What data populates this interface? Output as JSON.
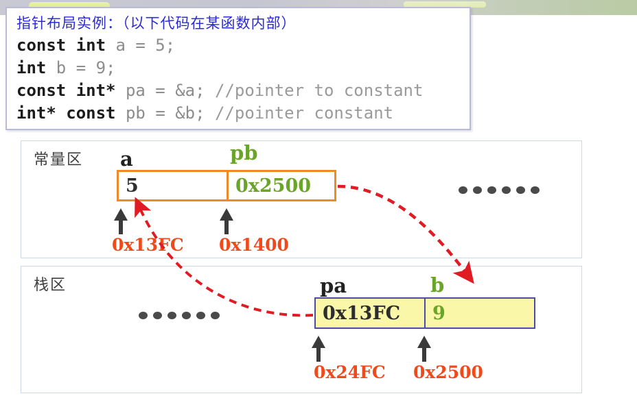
{
  "code_card": {
    "title": "指针布局实例：（以下代码在某函数内部）",
    "lines": [
      {
        "kw1": "const int",
        "rest": " a = 5;",
        "comment": ""
      },
      {
        "kw1": "int",
        "rest": " b = 9;",
        "comment": ""
      },
      {
        "kw1": "const int",
        "star": "*",
        "rest": " pa = &a; ",
        "comment": "//pointer to constant"
      },
      {
        "kw1": "int",
        "star": "*",
        "kw2": " const",
        "rest": " pb = &b; ",
        "comment": "//pointer constant"
      }
    ],
    "raw": {
      "line1": "const int a = 5;",
      "line2": "int b = 9;",
      "line3": "const int* pa = &a; //pointer to constant",
      "line4": "int* const pb = &b; //pointer constant"
    }
  },
  "panels": [
    {
      "id": "const",
      "title": "常量区",
      "cells": [
        {
          "var": "a",
          "value": "5",
          "address": "0x13FC",
          "value_color": "#2d2d2d",
          "var_color": "#222222"
        },
        {
          "var": "pb",
          "value": "0x2500",
          "address": "0x1400",
          "value_color": "#6aa428",
          "var_color": "#6aa428"
        }
      ],
      "ellipsis": "••••••",
      "border_color": "#ef8b24",
      "fill_color": "#ffffff"
    },
    {
      "id": "stack",
      "title": "栈区",
      "cells": [
        {
          "var": "pa",
          "value": "0x13FC",
          "address": "0x24FC",
          "value_color": "#2d2d2d",
          "var_color": "#222222"
        },
        {
          "var": "b",
          "value": "9",
          "address": "0x2500",
          "value_color": "#6aa428",
          "var_color": "#6aa428"
        }
      ],
      "ellipsis": "••••••",
      "border_color": "#4b4ba8",
      "fill_color": "#fbf7a8"
    }
  ],
  "pointer_arrows": [
    {
      "name": "pb-points-to-b",
      "from": "pb cell (0x2500)",
      "to": "b cell",
      "color": "#e01b24"
    },
    {
      "name": "pa-points-to-a",
      "from": "pa cell (0x13FC)",
      "to": "a cell",
      "color": "#e01b24"
    }
  ],
  "colors": {
    "accent_orange": "#ef8b24",
    "accent_green": "#6aa428",
    "accent_red": "#ef4a1c",
    "arrow_red": "#e01b24",
    "accent_blue": "#4b4ba8",
    "code_blue": "#2b2bd6",
    "panel_border": "#cfd6e4"
  }
}
